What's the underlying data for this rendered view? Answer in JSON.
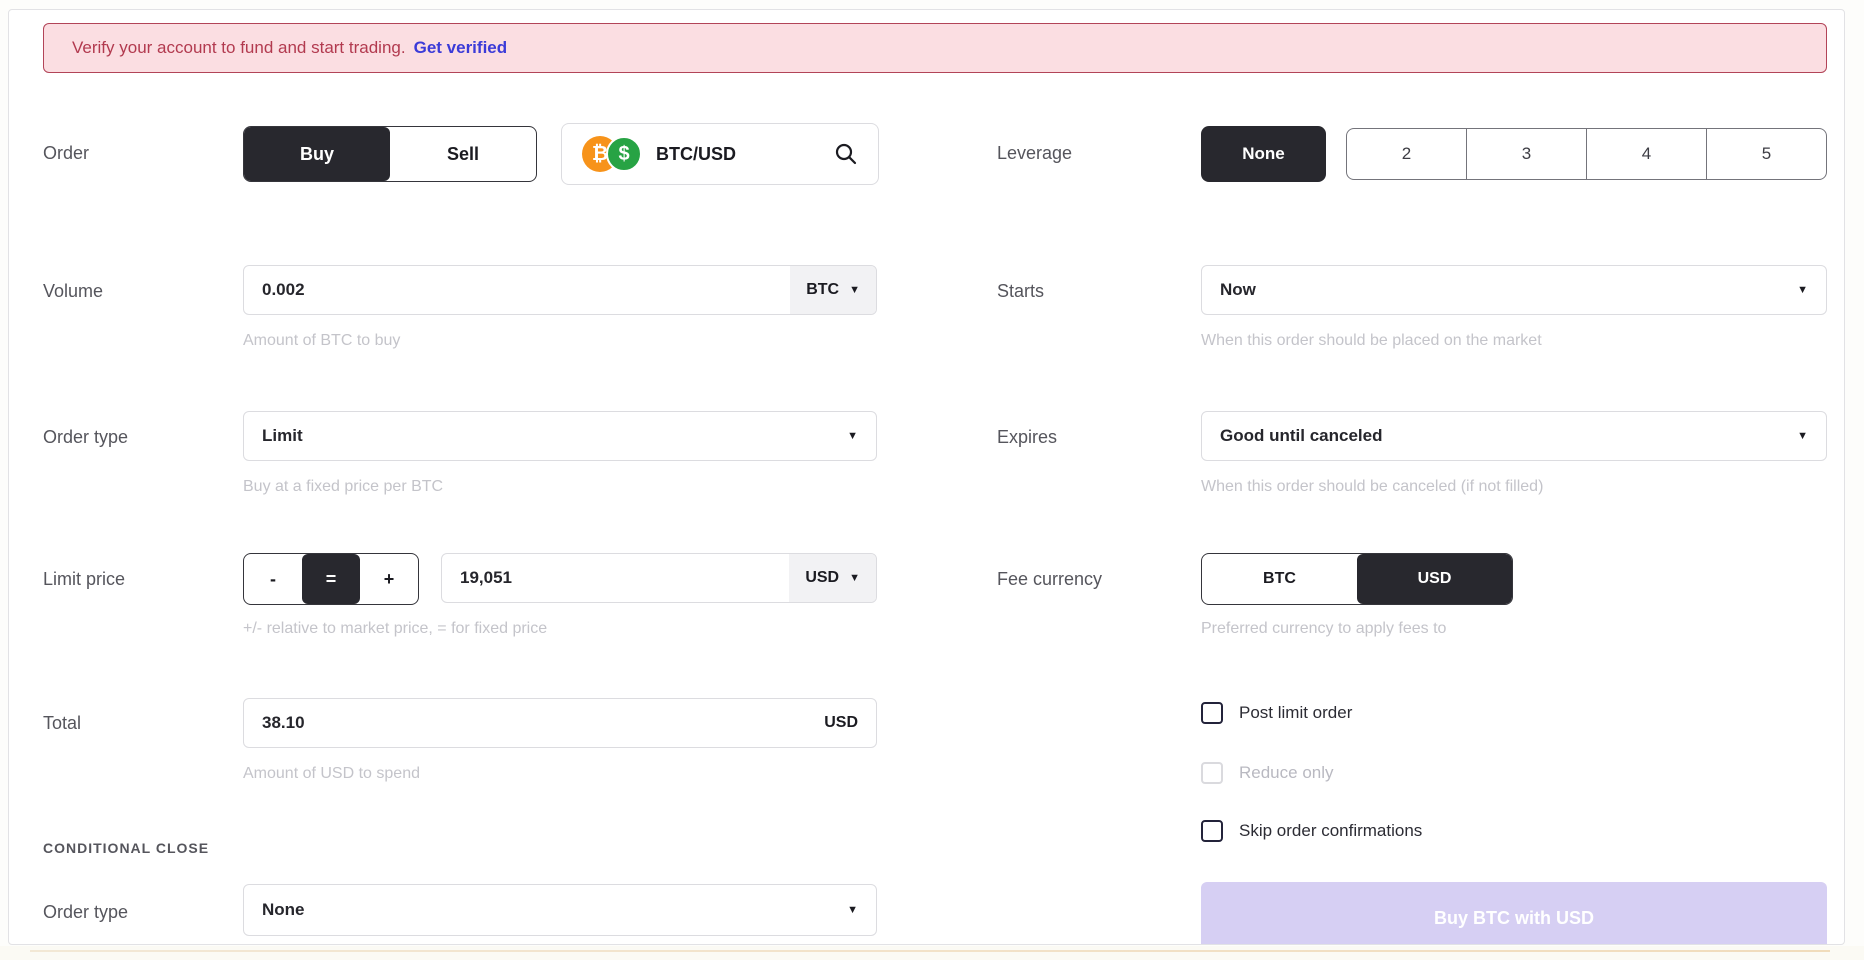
{
  "banner": {
    "message": "Verify your account to fund and start trading.",
    "link_label": "Get verified"
  },
  "order": {
    "label": "Order",
    "buy_label": "Buy",
    "sell_label": "Sell",
    "pair": "BTC/USD",
    "btc_symbol": "₿",
    "usd_symbol": "$"
  },
  "leverage": {
    "label": "Leverage",
    "none_label": "None",
    "options": [
      "2",
      "3",
      "4",
      "5"
    ]
  },
  "volume": {
    "label": "Volume",
    "value": "0.002",
    "unit": "BTC",
    "hint": "Amount of BTC to buy"
  },
  "starts": {
    "label": "Starts",
    "value": "Now",
    "hint": "When this order should be placed on the market"
  },
  "order_type": {
    "label": "Order type",
    "value": "Limit",
    "hint": "Buy at a fixed price per BTC"
  },
  "expires": {
    "label": "Expires",
    "value": "Good until canceled",
    "hint": "When this order should be canceled (if not filled)"
  },
  "limit_price": {
    "label": "Limit price",
    "minus": "-",
    "equals": "=",
    "plus": "+",
    "value": "19,051",
    "unit": "USD",
    "hint": "+/- relative to market price, = for fixed price"
  },
  "fee_currency": {
    "label": "Fee currency",
    "btc_label": "BTC",
    "usd_label": "USD",
    "hint": "Preferred currency to apply fees to"
  },
  "total": {
    "label": "Total",
    "value": "38.10",
    "unit": "USD",
    "hint": "Amount of USD to spend"
  },
  "options": {
    "post_limit": "Post limit order",
    "reduce_only": "Reduce only",
    "skip_confirm": "Skip order confirmations"
  },
  "conditional_close": {
    "header": "CONDITIONAL CLOSE",
    "order_type_label": "Order type",
    "order_type_value": "None"
  },
  "submit": {
    "label": "Buy BTC with USD"
  },
  "chevron": "▼",
  "colors": {
    "accent_dark": "#28282e",
    "banner_bg": "#fbdee2",
    "banner_border": "#b24458",
    "banner_text": "#b23a4f",
    "link": "#3b3bd8",
    "submit_bg": "#d6cff3",
    "btc_coin": "#f7931a",
    "usd_coin": "#27a344"
  }
}
